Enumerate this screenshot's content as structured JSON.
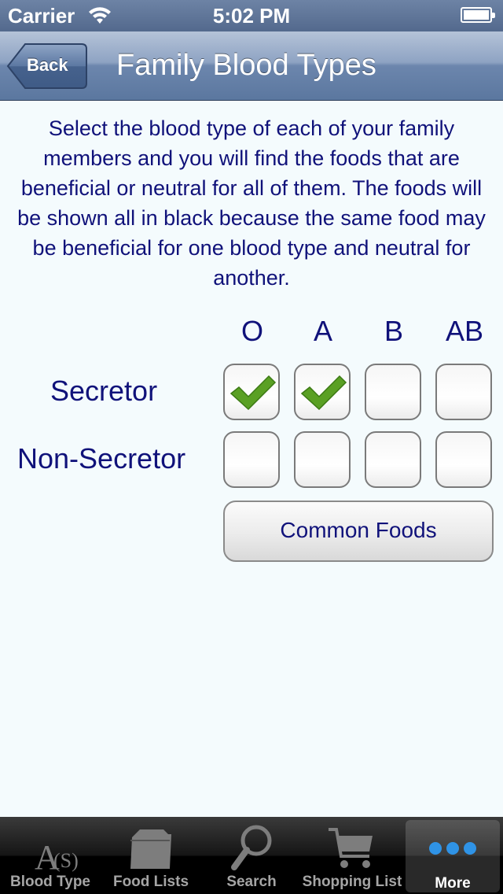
{
  "status_bar": {
    "carrier": "Carrier",
    "time": "5:02 PM"
  },
  "nav": {
    "back_label": "Back",
    "title": "Family Blood Types"
  },
  "intro_text": "Select the blood type of each of your family members and you will find the foods that are beneficial or neutral for all of them. The foods will be shown all in black because the same food may be beneficial for one blood type and neutral for another.",
  "blood_types": [
    "O",
    "A",
    "B",
    "AB"
  ],
  "rows": [
    {
      "label": "Secretor",
      "checked": [
        true,
        true,
        false,
        false
      ]
    },
    {
      "label": "Non-Secretor",
      "checked": [
        false,
        false,
        false,
        false
      ]
    }
  ],
  "common_foods_label": "Common Foods",
  "tabs": [
    {
      "label": "Blood Type",
      "icon": "blood-type-icon"
    },
    {
      "label": "Food Lists",
      "icon": "folder-icon"
    },
    {
      "label": "Search",
      "icon": "magnifier-icon"
    },
    {
      "label": "Shopping List",
      "icon": "cart-icon"
    },
    {
      "label": "More",
      "icon": "more-dots-icon",
      "selected": true
    }
  ],
  "colors": {
    "text": "#10127a",
    "navbar": "#5b779f",
    "check": "#5aa024"
  }
}
